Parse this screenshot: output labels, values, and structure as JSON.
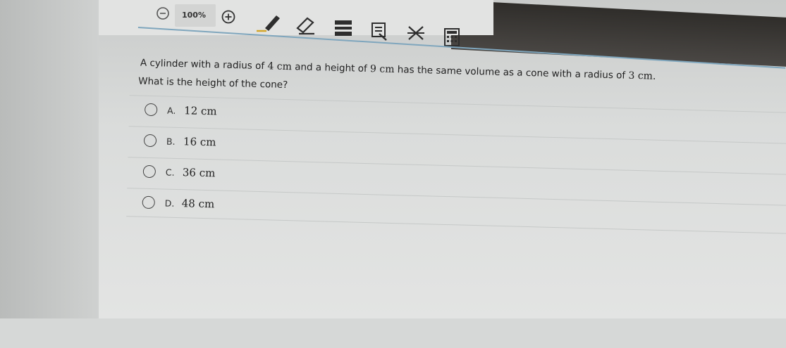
{
  "toolbar": {
    "zoom_level": "100%",
    "icons": [
      "zoom-out-icon",
      "zoom-in-icon",
      "pencil-icon",
      "eraser-icon",
      "highlighter-icon",
      "answer-masking-icon",
      "answer-eliminator-icon",
      "calculator-icon"
    ]
  },
  "question": {
    "part1": "A cylinder with a radius of ",
    "radius_cyl": "4 cm",
    "part2": " and a height of ",
    "height_cyl": "9 cm",
    "part3": " has the same volume as a cone with a radius of ",
    "radius_cone": "3 cm.",
    "prompt": "What is the height of the cone?"
  },
  "options": [
    {
      "letter": "A.",
      "value": "12 cm"
    },
    {
      "letter": "B.",
      "value": "16 cm"
    },
    {
      "letter": "C.",
      "value": "36 cm"
    },
    {
      "letter": "D.",
      "value": "48 cm"
    }
  ],
  "colors": {
    "accent_rule": "#7fa6bd",
    "toolbar_icon": "#2e2e2e",
    "highlighter": "#d4a62a"
  }
}
